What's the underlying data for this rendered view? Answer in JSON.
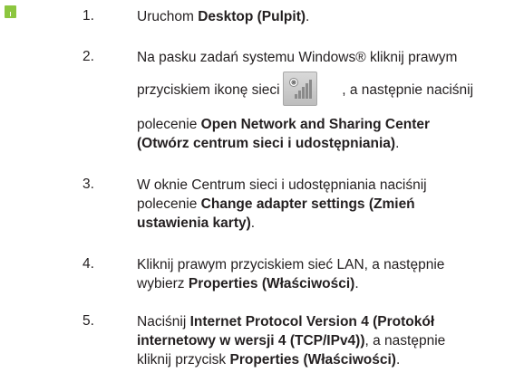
{
  "steps": [
    {
      "number": "1.",
      "lines": [
        {
          "text": "Uruchom ",
          "bold": "Desktop (Pulpit)",
          "after": "."
        }
      ]
    },
    {
      "number": "2.",
      "lines": [
        {
          "text": "Na pasku zadań systemu Windows® kliknij prawym"
        },
        {
          "text": "przyciskiem ikonę sieci",
          "after": ", a następnie naciśnij"
        },
        {
          "text": "polecenie ",
          "bold": "Open Network and Sharing Center"
        },
        {
          "bold": "(Otwórz centrum sieci i udostępniania)",
          "after": "."
        }
      ],
      "icon": "network-signal-icon"
    },
    {
      "number": "3.",
      "lines": [
        {
          "text": "W oknie Centrum sieci i udostępniania naciśnij"
        },
        {
          "text": "polecenie ",
          "bold": "Change adapter settings (Zmień"
        },
        {
          "bold": "ustawienia karty)",
          "after": "."
        }
      ]
    },
    {
      "number": "4.",
      "lines": [
        {
          "text": "Kliknij prawym przyciskiem sieć LAN, a następnie"
        },
        {
          "text": "wybierz ",
          "bold": "Properties (Właściwości)",
          "after": "."
        }
      ]
    },
    {
      "number": "5.",
      "lines": [
        {
          "text": "Naciśnij ",
          "bold": "Internet Protocol Version 4 (Protokół"
        },
        {
          "bold": "internetowy w wersji 4 (TCP/IPv4))",
          "after": ", a następnie"
        },
        {
          "text": "kliknij przycisk ",
          "bold": "Properties (Właściwości)",
          "after": "."
        }
      ]
    }
  ],
  "colors": {
    "tab_marker": "#8cc63f",
    "text": "#231f20"
  }
}
